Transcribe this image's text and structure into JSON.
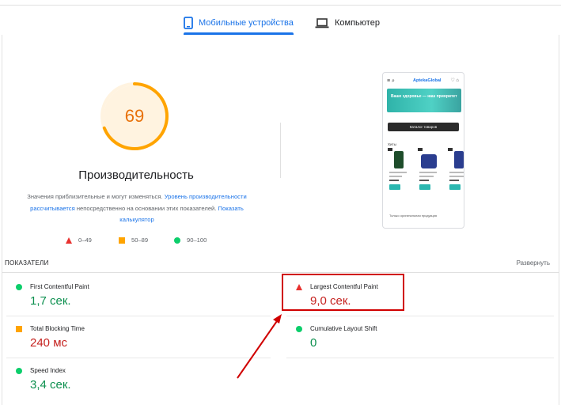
{
  "tabs": [
    {
      "label": "Мобильные устройства",
      "active": true
    },
    {
      "label": "Компьютер",
      "active": false
    }
  ],
  "score": {
    "value": 69,
    "fraction": 0.69,
    "color": "#ffa400"
  },
  "performance_title": "Производительность",
  "description": {
    "prefix": "Значения приблизительные и могут изменяться.",
    "link1": "Уровень производительности рассчитывается",
    "middle": "непосредственно на основании этих показателей.",
    "link2": "Показать калькулятор"
  },
  "legend": [
    {
      "range": "0–49",
      "shape": "triangle",
      "color": "#e8312f"
    },
    {
      "range": "50–89",
      "shape": "square",
      "color": "#ffa400"
    },
    {
      "range": "90–100",
      "shape": "circle",
      "color": "#0cce6b"
    }
  ],
  "preview": {
    "logo": "AptekaGlobal",
    "banner_text": "Ваше здоровье — наш приоритет",
    "catalog_button": "Каталог товаров",
    "section": "Хиты",
    "footer": "Только оригинальная продукция"
  },
  "metrics_header": "ПОКАЗАТЕЛИ",
  "expand_label": "Развернуть",
  "metrics": [
    {
      "name": "First Contentful Paint",
      "value": "1,7 сек.",
      "status": "good"
    },
    {
      "name": "Largest Contentful Paint",
      "value": "9,0 сек.",
      "status": "poor"
    },
    {
      "name": "Total Blocking Time",
      "value": "240 мс",
      "status": "average"
    },
    {
      "name": "Cumulative Layout Shift",
      "value": "0",
      "status": "good"
    },
    {
      "name": "Speed Index",
      "value": "3,4 сек.",
      "status": "good"
    }
  ],
  "annotation": {
    "color": "#d00000"
  }
}
